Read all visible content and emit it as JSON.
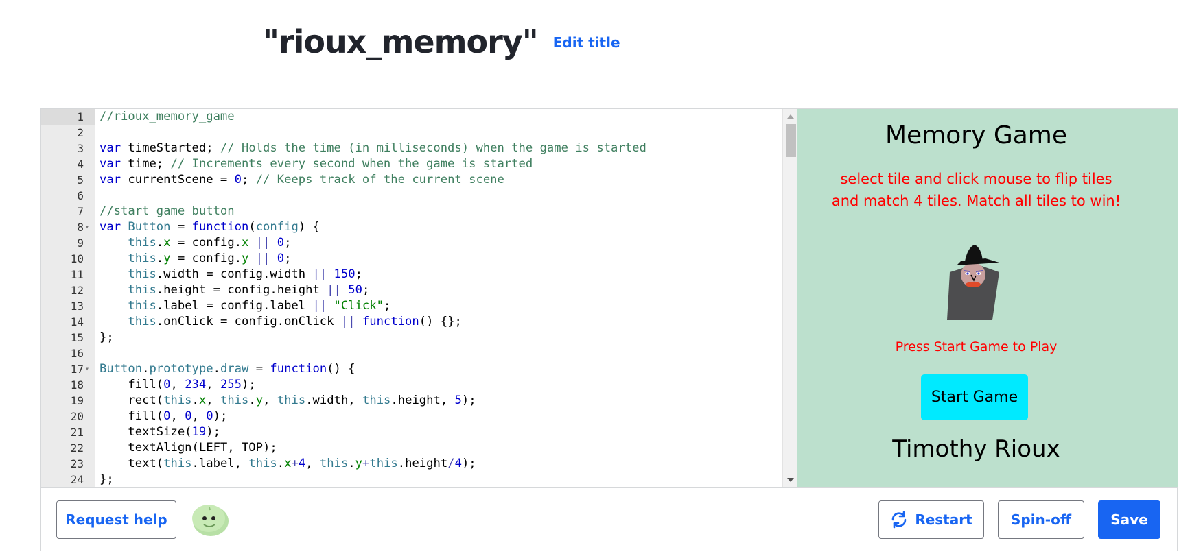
{
  "header": {
    "title": "\"rioux_memory\"",
    "edit_title_label": "Edit title"
  },
  "editor": {
    "active_line": 1,
    "lines": [
      {
        "n": "1",
        "fold": false,
        "tokens": [
          [
            "c",
            "//rioux_memory_game"
          ]
        ]
      },
      {
        "n": "2",
        "fold": false,
        "tokens": []
      },
      {
        "n": "3",
        "fold": false,
        "tokens": [
          [
            "k",
            "var"
          ],
          [
            "",
            " timeStarted; "
          ],
          [
            "c",
            "// Holds the time (in milliseconds) when the game is started"
          ]
        ]
      },
      {
        "n": "4",
        "fold": false,
        "tokens": [
          [
            "k",
            "var"
          ],
          [
            "",
            " time; "
          ],
          [
            "c",
            "// Increments every second when the game is started"
          ]
        ]
      },
      {
        "n": "5",
        "fold": false,
        "tokens": [
          [
            "k",
            "var"
          ],
          [
            "",
            " currentScene = "
          ],
          [
            "n",
            "0"
          ],
          [
            "",
            "; "
          ],
          [
            "c",
            "// Keeps track of the current scene"
          ]
        ]
      },
      {
        "n": "6",
        "fold": false,
        "tokens": []
      },
      {
        "n": "7",
        "fold": false,
        "tokens": [
          [
            "c",
            "//start game button"
          ]
        ]
      },
      {
        "n": "8",
        "fold": true,
        "tokens": [
          [
            "k",
            "var"
          ],
          [
            "",
            " "
          ],
          [
            "t",
            "Button"
          ],
          [
            "",
            " = "
          ],
          [
            "k",
            "function"
          ],
          [
            "",
            "("
          ],
          [
            "t",
            "config"
          ],
          [
            "",
            ") {"
          ]
        ]
      },
      {
        "n": "9",
        "fold": false,
        "tokens": [
          [
            "",
            "    "
          ],
          [
            "t",
            "this"
          ],
          [
            "",
            "."
          ],
          [
            "p",
            "x"
          ],
          [
            "",
            " = config."
          ],
          [
            "p",
            "x"
          ],
          [
            "",
            " "
          ],
          [
            "o",
            "||"
          ],
          [
            "",
            " "
          ],
          [
            "n",
            "0"
          ],
          [
            "",
            ";"
          ]
        ]
      },
      {
        "n": "10",
        "fold": false,
        "tokens": [
          [
            "",
            "    "
          ],
          [
            "t",
            "this"
          ],
          [
            "",
            "."
          ],
          [
            "p",
            "y"
          ],
          [
            "",
            " = config."
          ],
          [
            "p",
            "y"
          ],
          [
            "",
            " "
          ],
          [
            "o",
            "||"
          ],
          [
            "",
            " "
          ],
          [
            "n",
            "0"
          ],
          [
            "",
            ";"
          ]
        ]
      },
      {
        "n": "11",
        "fold": false,
        "tokens": [
          [
            "",
            "    "
          ],
          [
            "t",
            "this"
          ],
          [
            "",
            ".width = config.width "
          ],
          [
            "o",
            "||"
          ],
          [
            "",
            " "
          ],
          [
            "n",
            "150"
          ],
          [
            "",
            ";"
          ]
        ]
      },
      {
        "n": "12",
        "fold": false,
        "tokens": [
          [
            "",
            "    "
          ],
          [
            "t",
            "this"
          ],
          [
            "",
            ".height = config.height "
          ],
          [
            "o",
            "||"
          ],
          [
            "",
            " "
          ],
          [
            "n",
            "50"
          ],
          [
            "",
            ";"
          ]
        ]
      },
      {
        "n": "13",
        "fold": false,
        "tokens": [
          [
            "",
            "    "
          ],
          [
            "t",
            "this"
          ],
          [
            "",
            ".label = config.label "
          ],
          [
            "o",
            "||"
          ],
          [
            "",
            " "
          ],
          [
            "s",
            "\"Click\""
          ],
          [
            "",
            ";"
          ]
        ]
      },
      {
        "n": "14",
        "fold": false,
        "tokens": [
          [
            "",
            "    "
          ],
          [
            "t",
            "this"
          ],
          [
            "",
            ".onClick = config.onClick "
          ],
          [
            "o",
            "||"
          ],
          [
            "",
            " "
          ],
          [
            "k",
            "function"
          ],
          [
            "",
            "() {};"
          ]
        ]
      },
      {
        "n": "15",
        "fold": false,
        "tokens": [
          [
            "",
            "};"
          ]
        ]
      },
      {
        "n": "16",
        "fold": false,
        "tokens": []
      },
      {
        "n": "17",
        "fold": true,
        "tokens": [
          [
            "t",
            "Button"
          ],
          [
            "",
            "."
          ],
          [
            "t",
            "prototype"
          ],
          [
            "",
            "."
          ],
          [
            "t",
            "draw"
          ],
          [
            "",
            " = "
          ],
          [
            "k",
            "function"
          ],
          [
            "",
            "() {"
          ]
        ]
      },
      {
        "n": "18",
        "fold": false,
        "tokens": [
          [
            "",
            "    fill("
          ],
          [
            "n",
            "0"
          ],
          [
            "",
            ", "
          ],
          [
            "n",
            "234"
          ],
          [
            "",
            ", "
          ],
          [
            "n",
            "255"
          ],
          [
            "",
            ");"
          ]
        ]
      },
      {
        "n": "19",
        "fold": false,
        "tokens": [
          [
            "",
            "    rect("
          ],
          [
            "t",
            "this"
          ],
          [
            "",
            "."
          ],
          [
            "p",
            "x"
          ],
          [
            "",
            ", "
          ],
          [
            "t",
            "this"
          ],
          [
            "",
            "."
          ],
          [
            "p",
            "y"
          ],
          [
            "",
            ", "
          ],
          [
            "t",
            "this"
          ],
          [
            "",
            ".width, "
          ],
          [
            "t",
            "this"
          ],
          [
            "",
            ".height, "
          ],
          [
            "n",
            "5"
          ],
          [
            "",
            ");"
          ]
        ]
      },
      {
        "n": "20",
        "fold": false,
        "tokens": [
          [
            "",
            "    fill("
          ],
          [
            "n",
            "0"
          ],
          [
            "",
            ", "
          ],
          [
            "n",
            "0"
          ],
          [
            "",
            ", "
          ],
          [
            "n",
            "0"
          ],
          [
            "",
            ");"
          ]
        ]
      },
      {
        "n": "21",
        "fold": false,
        "tokens": [
          [
            "",
            "    textSize("
          ],
          [
            "n",
            "19"
          ],
          [
            "",
            ");"
          ]
        ]
      },
      {
        "n": "22",
        "fold": false,
        "tokens": [
          [
            "",
            "    textAlign(LEFT, TOP);"
          ]
        ]
      },
      {
        "n": "23",
        "fold": false,
        "tokens": [
          [
            "",
            "    text("
          ],
          [
            "t",
            "this"
          ],
          [
            "",
            ".label, "
          ],
          [
            "t",
            "this"
          ],
          [
            "",
            "."
          ],
          [
            "p",
            "x"
          ],
          [
            "o",
            "+"
          ],
          [
            "n",
            "4"
          ],
          [
            "",
            ", "
          ],
          [
            "t",
            "this"
          ],
          [
            "",
            "."
          ],
          [
            "p",
            "y"
          ],
          [
            "o",
            "+"
          ],
          [
            "t",
            "this"
          ],
          [
            "",
            ".height"
          ],
          [
            "o",
            "/"
          ],
          [
            "n",
            "4"
          ],
          [
            "",
            ");"
          ]
        ]
      },
      {
        "n": "24",
        "fold": false,
        "tokens": [
          [
            "",
            "};"
          ]
        ]
      }
    ]
  },
  "canvas": {
    "background": "#bce0cd",
    "title": "Memory Game",
    "instructions_line1": "select tile and click mouse to flip tiles",
    "instructions_line2": "and match 4 tiles. Match all tiles to win!",
    "press_start": "Press Start Game to Play",
    "start_button": "Start Game",
    "author": "Timothy Rioux"
  },
  "toolbar": {
    "request_help_label": "Request help",
    "restart_label": "Restart",
    "spinoff_label": "Spin-off",
    "save_label": "Save",
    "accent": "#1865f2"
  },
  "icons": {
    "restart": "refresh-icon",
    "avatar": "green-blob-avatar"
  }
}
